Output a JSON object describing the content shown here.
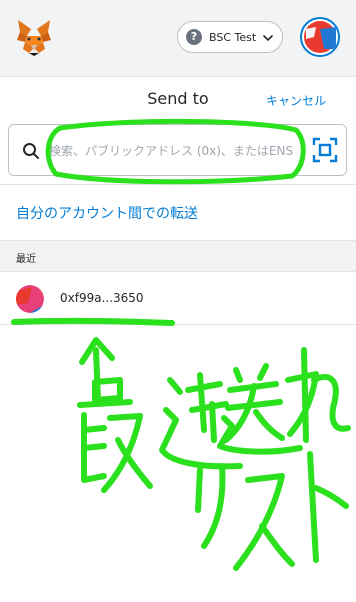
{
  "network": {
    "label": "BSC Test",
    "help_glyph": "?"
  },
  "header": {
    "title": "Send to",
    "cancel_label": "キャンセル"
  },
  "search": {
    "placeholder": "検索、パブリックアドレス (0x)、またはENS"
  },
  "transfer_link": "自分のアカウント間での転送",
  "recent": {
    "section_label": "最近",
    "items": [
      {
        "address": "0xf99a...3650"
      }
    ]
  },
  "colors": {
    "accent": "#037dd6",
    "annotation": "#2be01d",
    "fox_orange": "#e2761b",
    "avatar_red": "#e83a2f",
    "avatar_blue": "#1f78d1",
    "avatar_pink": "#e8407a"
  }
}
